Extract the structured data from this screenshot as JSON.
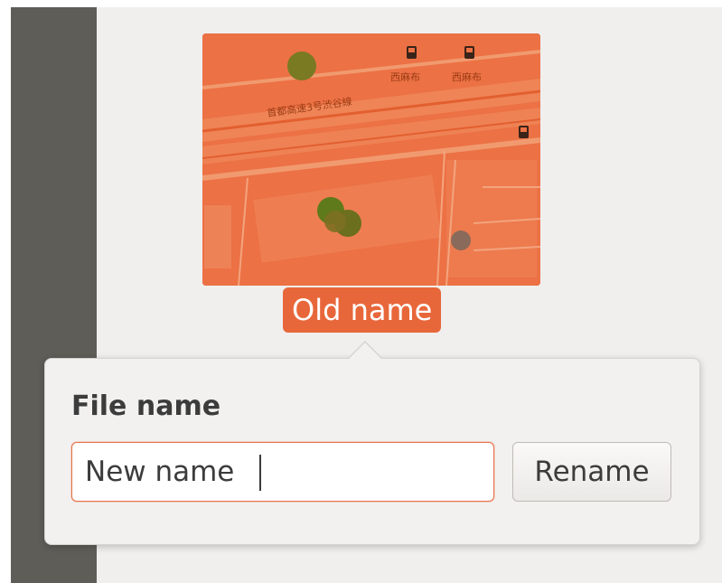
{
  "thumbnail": {
    "map_labels": [
      "西麻布",
      "西麻布",
      "首都高速3号渋谷線"
    ],
    "icons": [
      "bus-stop-icon",
      "bus-stop-icon",
      "bus-stop-icon"
    ]
  },
  "item": {
    "old_name": "Old name"
  },
  "rename_popover": {
    "label": "File name",
    "input_value": "New name",
    "button_label": "Rename"
  },
  "colors": {
    "accent": "#e8673a",
    "sidebar": "#5f5d58",
    "background": "#f0efee"
  }
}
